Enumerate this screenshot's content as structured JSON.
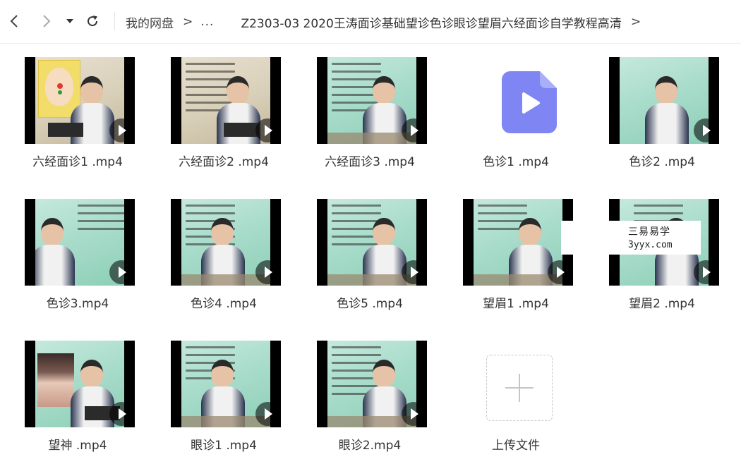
{
  "nav": {
    "back_icon": "chevron-left-icon",
    "forward_icon": "chevron-right-icon",
    "dropdown_icon": "caret-down-icon",
    "refresh_icon": "refresh-icon"
  },
  "breadcrumb": {
    "root": "我的网盘",
    "separator": ">",
    "ellipsis": "...",
    "current": "Z2303-03 2020王涛面诊基础望诊色诊眼诊望眉六经面诊自学教程高清",
    "trailing_separator": ">"
  },
  "files": [
    {
      "name": "六经面诊1 .mp4"
    },
    {
      "name": "六经面诊2 .mp4"
    },
    {
      "name": "六经面诊3 .mp4"
    },
    {
      "name": "色诊1 .mp4"
    },
    {
      "name": "色诊2 .mp4"
    },
    {
      "name": "色诊3.mp4"
    },
    {
      "name": "色诊4 .mp4"
    },
    {
      "name": "色诊5 .mp4"
    },
    {
      "name": "望眉1 .mp4"
    },
    {
      "name": "望眉2 .mp4"
    },
    {
      "name": "望神 .mp4"
    },
    {
      "name": "眼诊1 .mp4"
    },
    {
      "name": "眼诊2.mp4"
    }
  ],
  "upload": {
    "label": "上传文件",
    "icon": "plus-icon"
  },
  "watermark": {
    "line1": "三易易学",
    "line2": "3yyx.com"
  },
  "colors": {
    "video_icon": "#7f86f4",
    "thumb_bg": "#a9dccb"
  }
}
